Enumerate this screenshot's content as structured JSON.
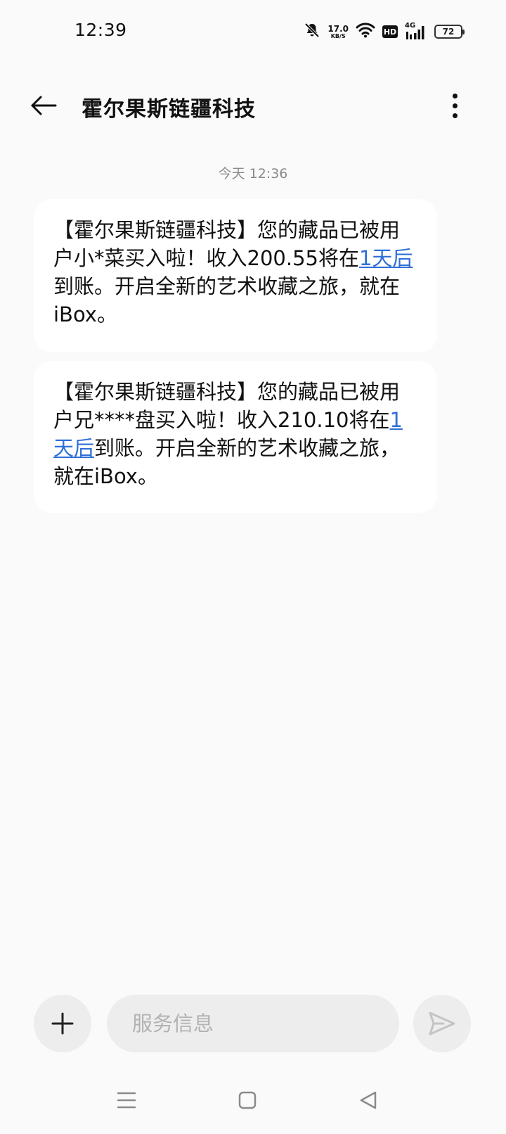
{
  "status_bar": {
    "time": "12:39",
    "net_speed_value": "17.0",
    "net_speed_unit": "KB/S",
    "hd_label": "HD",
    "network_label": "4G",
    "battery_level": "72"
  },
  "header": {
    "title": "霍尔果斯链疆科技"
  },
  "conversation": {
    "date_stamp": "今天 12:36",
    "messages": [
      {
        "before_link": "【霍尔果斯链疆科技】您的藏品已被用户小*菜买入啦！收入200.55将在",
        "link_text": "1天后",
        "after_link": "到账。开启全新的艺术收藏之旅，就在iBox。"
      },
      {
        "before_link": "【霍尔果斯链疆科技】您的藏品已被用户兄****盘买入啦！收入210.10将在",
        "link_text": "1天后",
        "after_link": "到账。开启全新的艺术收藏之旅，就在iBox。"
      }
    ]
  },
  "composer": {
    "placeholder": "服务信息",
    "add_icon": "plus-icon",
    "send_icon": "send-icon"
  },
  "nav": {
    "menu_icon": "menu-icon",
    "home_icon": "home-icon",
    "back_icon": "back-triangle-icon"
  },
  "colors": {
    "background": "#fafafa",
    "bubble": "#ffffff",
    "link": "#2f6fd8",
    "control": "#ededed"
  }
}
